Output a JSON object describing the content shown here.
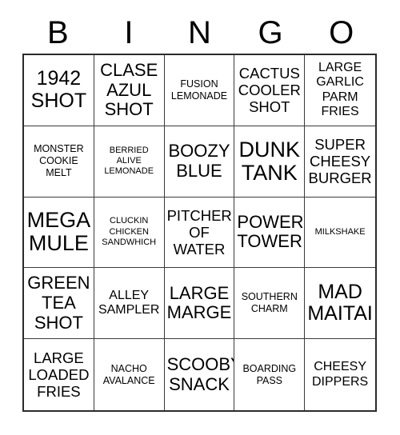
{
  "card": {
    "type": "bingo-card",
    "header_letters": [
      "B",
      "I",
      "N",
      "G",
      "O"
    ],
    "columns": 5,
    "rows": 5,
    "colors": {
      "background": "#ffffff",
      "text": "#000000",
      "grid_line": "#3a3a3a",
      "grid_outer_border": "#2b2b2b"
    },
    "cells": [
      {
        "text": "1942\nSHOT",
        "size": "fs-xxl"
      },
      {
        "text": "CLASE\nAZUL\nSHOT",
        "size": "fs-xl"
      },
      {
        "text": "FUSION\nLEMONADE",
        "size": "fs-sm"
      },
      {
        "text": "CACTUS\nCOOLER\nSHOT",
        "size": "fs-lg"
      },
      {
        "text": "LARGE\nGARLIC\nPARM\nFRIES",
        "size": "fs-md"
      },
      {
        "text": "MONSTER\nCOOKIE\nMELT",
        "size": "fs-sm"
      },
      {
        "text": "BERRIED\nALIVE\nLEMONADE",
        "size": "fs-xs"
      },
      {
        "text": "BOOZY\nBLUE",
        "size": "fs-xl"
      },
      {
        "text": "DUNK\nTANK",
        "size": "fs-max"
      },
      {
        "text": "SUPER\nCHEESY\nBURGER",
        "size": "fs-lg"
      },
      {
        "text": "MEGA\nMULE",
        "size": "fs-max"
      },
      {
        "text": "CLUCKIN\nCHICKEN\nSANDWHICH",
        "size": "fs-xs"
      },
      {
        "text": "PITCHER\nOF\nWATER",
        "size": "fs-lg"
      },
      {
        "text": "POWER\nTOWER",
        "size": "fs-xl"
      },
      {
        "text": "MILKSHAKE",
        "size": "fs-xs"
      },
      {
        "text": "GREEN\nTEA\nSHOT",
        "size": "fs-xl"
      },
      {
        "text": "ALLEY\nSAMPLER",
        "size": "fs-md"
      },
      {
        "text": "LARGE\nMARGE",
        "size": "fs-xl"
      },
      {
        "text": "SOUTHERN\nCHARM",
        "size": "fs-sm"
      },
      {
        "text": "MAD\nMAITAI",
        "size": "fs-xxl"
      },
      {
        "text": "LARGE\nLOADED\nFRIES",
        "size": "fs-lg"
      },
      {
        "text": "NACHO\nAVALANCE",
        "size": "fs-sm"
      },
      {
        "text": "SCOOBY\nSNACK",
        "size": "fs-xl"
      },
      {
        "text": "BOARDING\nPASS",
        "size": "fs-sm"
      },
      {
        "text": "CHEESY\nDIPPERS",
        "size": "fs-md"
      }
    ]
  }
}
